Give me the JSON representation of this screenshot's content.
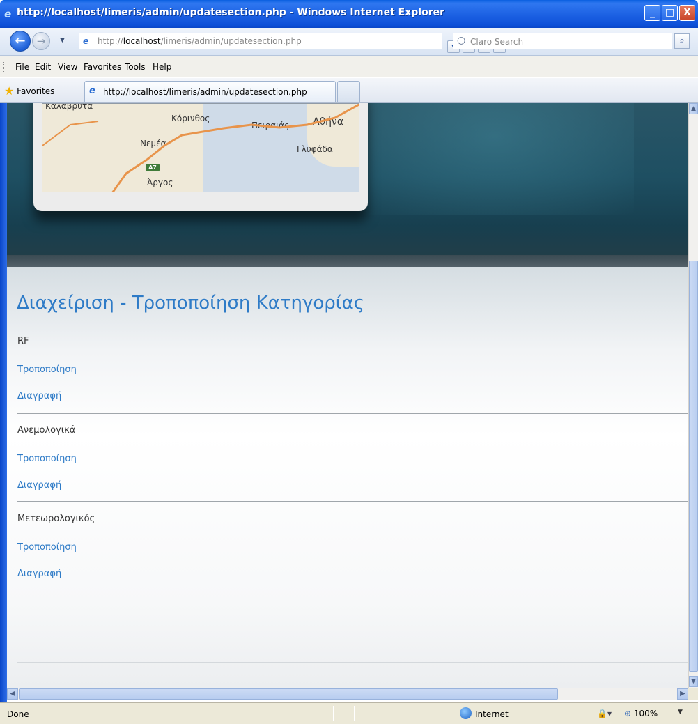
{
  "window": {
    "title": "http://localhost/limeris/admin/updatesection.php - Windows Internet Explorer",
    "buttons": {
      "minimize": "_",
      "maximize": "□",
      "close": "X"
    }
  },
  "addressbar": {
    "url_prefix": "http://",
    "url_host": "localhost",
    "url_path": "/limeris/admin/updatesection.php",
    "search_placeholder": "Claro Search"
  },
  "menu": [
    {
      "label": "File",
      "key": "F"
    },
    {
      "label": "Edit",
      "key": "E"
    },
    {
      "label": "View",
      "key": "V"
    },
    {
      "label": "Favorites",
      "key": "a"
    },
    {
      "label": "Tools",
      "key": "T"
    },
    {
      "label": "Help",
      "key": "H"
    }
  ],
  "favorites": {
    "label": "Favorites",
    "tab_label": "http://localhost/limeris/admin/updatesection.php"
  },
  "map": {
    "labels": [
      "Καλάβρυτα",
      "Κόρινθος",
      "Πειραιάς",
      "Αθήνα",
      "Νεμέα",
      "Γλυφάδα",
      "Άργος"
    ],
    "road_badge": "A7"
  },
  "page": {
    "title": "Διαχείριση - Τροποποίηση Κατηγορίας",
    "categories": [
      {
        "name": "RF",
        "edit": "Τροποποίηση",
        "delete": "Διαγραφή"
      },
      {
        "name": "Ανεμολογικά",
        "edit": "Τροποποίηση",
        "delete": "Διαγραφή"
      },
      {
        "name": "Μετεωρολογικός",
        "edit": "Τροποποίηση",
        "delete": "Διαγραφή"
      }
    ]
  },
  "statusbar": {
    "status": "Done",
    "zone": "Internet",
    "zoom": "100%"
  },
  "colors": {
    "link": "#2e7bc7",
    "title": "#2e7bc7",
    "banner": "#1e4f62",
    "titlebar": "#1e63e4"
  }
}
